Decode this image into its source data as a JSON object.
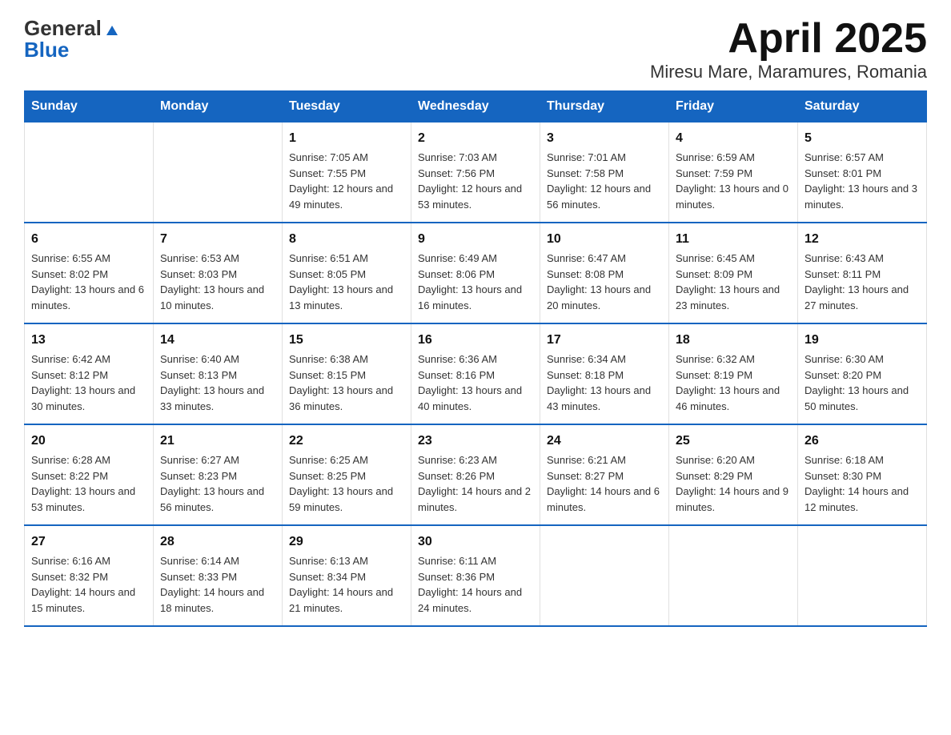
{
  "header": {
    "logo_general": "General",
    "logo_blue": "Blue",
    "title": "April 2025",
    "subtitle": "Miresu Mare, Maramures, Romania"
  },
  "weekdays": [
    "Sunday",
    "Monday",
    "Tuesday",
    "Wednesday",
    "Thursday",
    "Friday",
    "Saturday"
  ],
  "weeks": [
    [
      {
        "day": "",
        "sunrise": "",
        "sunset": "",
        "daylight": ""
      },
      {
        "day": "",
        "sunrise": "",
        "sunset": "",
        "daylight": ""
      },
      {
        "day": "1",
        "sunrise": "Sunrise: 7:05 AM",
        "sunset": "Sunset: 7:55 PM",
        "daylight": "Daylight: 12 hours and 49 minutes."
      },
      {
        "day": "2",
        "sunrise": "Sunrise: 7:03 AM",
        "sunset": "Sunset: 7:56 PM",
        "daylight": "Daylight: 12 hours and 53 minutes."
      },
      {
        "day": "3",
        "sunrise": "Sunrise: 7:01 AM",
        "sunset": "Sunset: 7:58 PM",
        "daylight": "Daylight: 12 hours and 56 minutes."
      },
      {
        "day": "4",
        "sunrise": "Sunrise: 6:59 AM",
        "sunset": "Sunset: 7:59 PM",
        "daylight": "Daylight: 13 hours and 0 minutes."
      },
      {
        "day": "5",
        "sunrise": "Sunrise: 6:57 AM",
        "sunset": "Sunset: 8:01 PM",
        "daylight": "Daylight: 13 hours and 3 minutes."
      }
    ],
    [
      {
        "day": "6",
        "sunrise": "Sunrise: 6:55 AM",
        "sunset": "Sunset: 8:02 PM",
        "daylight": "Daylight: 13 hours and 6 minutes."
      },
      {
        "day": "7",
        "sunrise": "Sunrise: 6:53 AM",
        "sunset": "Sunset: 8:03 PM",
        "daylight": "Daylight: 13 hours and 10 minutes."
      },
      {
        "day": "8",
        "sunrise": "Sunrise: 6:51 AM",
        "sunset": "Sunset: 8:05 PM",
        "daylight": "Daylight: 13 hours and 13 minutes."
      },
      {
        "day": "9",
        "sunrise": "Sunrise: 6:49 AM",
        "sunset": "Sunset: 8:06 PM",
        "daylight": "Daylight: 13 hours and 16 minutes."
      },
      {
        "day": "10",
        "sunrise": "Sunrise: 6:47 AM",
        "sunset": "Sunset: 8:08 PM",
        "daylight": "Daylight: 13 hours and 20 minutes."
      },
      {
        "day": "11",
        "sunrise": "Sunrise: 6:45 AM",
        "sunset": "Sunset: 8:09 PM",
        "daylight": "Daylight: 13 hours and 23 minutes."
      },
      {
        "day": "12",
        "sunrise": "Sunrise: 6:43 AM",
        "sunset": "Sunset: 8:11 PM",
        "daylight": "Daylight: 13 hours and 27 minutes."
      }
    ],
    [
      {
        "day": "13",
        "sunrise": "Sunrise: 6:42 AM",
        "sunset": "Sunset: 8:12 PM",
        "daylight": "Daylight: 13 hours and 30 minutes."
      },
      {
        "day": "14",
        "sunrise": "Sunrise: 6:40 AM",
        "sunset": "Sunset: 8:13 PM",
        "daylight": "Daylight: 13 hours and 33 minutes."
      },
      {
        "day": "15",
        "sunrise": "Sunrise: 6:38 AM",
        "sunset": "Sunset: 8:15 PM",
        "daylight": "Daylight: 13 hours and 36 minutes."
      },
      {
        "day": "16",
        "sunrise": "Sunrise: 6:36 AM",
        "sunset": "Sunset: 8:16 PM",
        "daylight": "Daylight: 13 hours and 40 minutes."
      },
      {
        "day": "17",
        "sunrise": "Sunrise: 6:34 AM",
        "sunset": "Sunset: 8:18 PM",
        "daylight": "Daylight: 13 hours and 43 minutes."
      },
      {
        "day": "18",
        "sunrise": "Sunrise: 6:32 AM",
        "sunset": "Sunset: 8:19 PM",
        "daylight": "Daylight: 13 hours and 46 minutes."
      },
      {
        "day": "19",
        "sunrise": "Sunrise: 6:30 AM",
        "sunset": "Sunset: 8:20 PM",
        "daylight": "Daylight: 13 hours and 50 minutes."
      }
    ],
    [
      {
        "day": "20",
        "sunrise": "Sunrise: 6:28 AM",
        "sunset": "Sunset: 8:22 PM",
        "daylight": "Daylight: 13 hours and 53 minutes."
      },
      {
        "day": "21",
        "sunrise": "Sunrise: 6:27 AM",
        "sunset": "Sunset: 8:23 PM",
        "daylight": "Daylight: 13 hours and 56 minutes."
      },
      {
        "day": "22",
        "sunrise": "Sunrise: 6:25 AM",
        "sunset": "Sunset: 8:25 PM",
        "daylight": "Daylight: 13 hours and 59 minutes."
      },
      {
        "day": "23",
        "sunrise": "Sunrise: 6:23 AM",
        "sunset": "Sunset: 8:26 PM",
        "daylight": "Daylight: 14 hours and 2 minutes."
      },
      {
        "day": "24",
        "sunrise": "Sunrise: 6:21 AM",
        "sunset": "Sunset: 8:27 PM",
        "daylight": "Daylight: 14 hours and 6 minutes."
      },
      {
        "day": "25",
        "sunrise": "Sunrise: 6:20 AM",
        "sunset": "Sunset: 8:29 PM",
        "daylight": "Daylight: 14 hours and 9 minutes."
      },
      {
        "day": "26",
        "sunrise": "Sunrise: 6:18 AM",
        "sunset": "Sunset: 8:30 PM",
        "daylight": "Daylight: 14 hours and 12 minutes."
      }
    ],
    [
      {
        "day": "27",
        "sunrise": "Sunrise: 6:16 AM",
        "sunset": "Sunset: 8:32 PM",
        "daylight": "Daylight: 14 hours and 15 minutes."
      },
      {
        "day": "28",
        "sunrise": "Sunrise: 6:14 AM",
        "sunset": "Sunset: 8:33 PM",
        "daylight": "Daylight: 14 hours and 18 minutes."
      },
      {
        "day": "29",
        "sunrise": "Sunrise: 6:13 AM",
        "sunset": "Sunset: 8:34 PM",
        "daylight": "Daylight: 14 hours and 21 minutes."
      },
      {
        "day": "30",
        "sunrise": "Sunrise: 6:11 AM",
        "sunset": "Sunset: 8:36 PM",
        "daylight": "Daylight: 14 hours and 24 minutes."
      },
      {
        "day": "",
        "sunrise": "",
        "sunset": "",
        "daylight": ""
      },
      {
        "day": "",
        "sunrise": "",
        "sunset": "",
        "daylight": ""
      },
      {
        "day": "",
        "sunrise": "",
        "sunset": "",
        "daylight": ""
      }
    ]
  ]
}
